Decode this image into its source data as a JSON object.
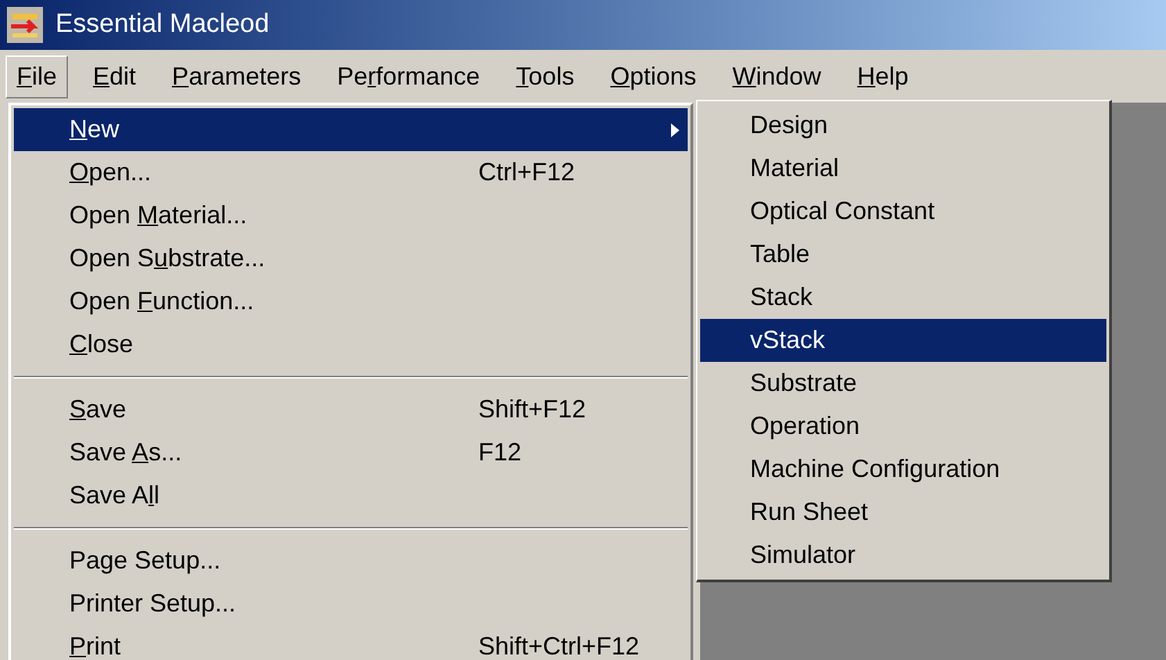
{
  "window": {
    "title": "Essential Macleod"
  },
  "menu_bar": [
    {
      "key": "F",
      "post": "ile",
      "selected": true
    },
    {
      "key": "E",
      "post": "dit",
      "selected": false
    },
    {
      "key": "P",
      "post": "arameters",
      "selected": false
    },
    {
      "pre": "Pe",
      "key": "r",
      "post": "formance",
      "selected": false
    },
    {
      "key": "T",
      "post": "ools",
      "selected": false
    },
    {
      "key": "O",
      "post": "ptions",
      "selected": false
    },
    {
      "key": "W",
      "post": "indow",
      "selected": false
    },
    {
      "key": "H",
      "post": "elp",
      "selected": false
    }
  ],
  "file_menu": [
    {
      "kind": "item",
      "key": "N",
      "post": "ew",
      "submenu": true,
      "selected": true
    },
    {
      "kind": "item",
      "key": "O",
      "post": "pen...",
      "shortcut": "Ctrl+F12",
      "selected": false
    },
    {
      "kind": "item",
      "pre": "Open ",
      "key": "M",
      "post": "aterial...",
      "selected": false
    },
    {
      "kind": "item",
      "pre": "Open S",
      "key": "u",
      "post": "bstrate...",
      "selected": false
    },
    {
      "kind": "item",
      "pre": "Open ",
      "key": "F",
      "post": "unction...",
      "selected": false
    },
    {
      "kind": "item",
      "key": "C",
      "post": "lose",
      "selected": false
    },
    {
      "kind": "separator"
    },
    {
      "kind": "item",
      "key": "S",
      "post": "ave",
      "shortcut": "Shift+F12",
      "selected": false
    },
    {
      "kind": "item",
      "pre": "Save ",
      "key": "A",
      "post": "s...",
      "shortcut": "F12",
      "selected": false
    },
    {
      "kind": "item",
      "pre": "Save A",
      "key": "l",
      "post": "l",
      "selected": false
    },
    {
      "kind": "separator"
    },
    {
      "kind": "item",
      "pre": "Page Setup...",
      "selected": false
    },
    {
      "kind": "item",
      "pre": "Printer Setup...",
      "selected": false
    },
    {
      "kind": "item",
      "key": "P",
      "post": "rint",
      "shortcut": "Shift+Ctrl+F12",
      "selected": false
    }
  ],
  "new_submenu": [
    {
      "label": "Design",
      "selected": false
    },
    {
      "label": "Material",
      "selected": false
    },
    {
      "label": "Optical Constant",
      "selected": false
    },
    {
      "label": "Table",
      "selected": false
    },
    {
      "label": "Stack",
      "selected": false
    },
    {
      "label": "vStack",
      "selected": true
    },
    {
      "label": "Substrate",
      "selected": false
    },
    {
      "label": "Operation",
      "selected": false
    },
    {
      "label": "Machine Configuration",
      "selected": false
    },
    {
      "label": "Run Sheet",
      "selected": false
    },
    {
      "label": "Simulator",
      "selected": false
    }
  ]
}
